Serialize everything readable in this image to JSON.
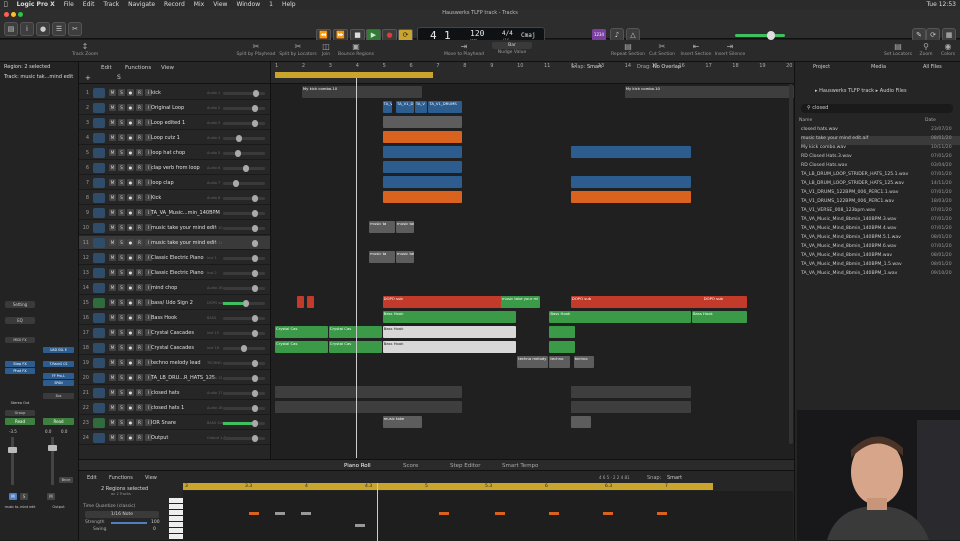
{
  "menubar": {
    "items": [
      "Logic Pro X",
      "File",
      "Edit",
      "Track",
      "Navigate",
      "Record",
      "Mix",
      "View",
      "Window",
      "1",
      "Help"
    ],
    "time": "Tue 12:53"
  },
  "window_title": "Hauswerks TLFP track - Tracks",
  "lcd": {
    "bar": "4",
    "beat": "1",
    "tempo": "120",
    "tempo_label": "KEEP",
    "timesig": "4/4",
    "timesig_bottom": "/16",
    "key": "Cmaj",
    "bar_label": "BAR",
    "beat_label": "BEAT",
    "tempo_sub": "TEMPO"
  },
  "cpu_label": "1234",
  "toolbar2": [
    {
      "label": "Track Zoom",
      "icon": "zoom-icon"
    },
    {
      "label": "Split by Playhead",
      "icon": "scissors-icon"
    },
    {
      "label": "Split by Locators",
      "icon": "split-icon"
    },
    {
      "label": "Join",
      "icon": "join-icon"
    },
    {
      "label": "Bounce Regions",
      "icon": "bounce-icon"
    },
    {
      "label": "Move to Playhead",
      "icon": "move-icon"
    },
    {
      "label": "Nudge Value",
      "icon": "nudge-icon"
    },
    {
      "label": "Repeat Section",
      "icon": "repeat-icon"
    },
    {
      "label": "Cut Section",
      "icon": "cut-icon"
    },
    {
      "label": "Insert Section",
      "icon": "insert-icon"
    },
    {
      "label": "Insert Silence",
      "icon": "silence-icon"
    },
    {
      "label": "Set Locators",
      "icon": "locators-icon"
    },
    {
      "label": "Zoom",
      "icon": "magnify-icon"
    },
    {
      "label": "Colors",
      "icon": "palette-icon"
    }
  ],
  "nudge_value": "Bar",
  "inspector": {
    "region": "Region: 2 selected",
    "track": "Track: music tak...mind edit",
    "setting": "Setting",
    "eq": "EQ",
    "midi_fx": "MIDI FX",
    "audio_fx": "Step FX",
    "audio_fx2": "Phat FX",
    "uad": "UAD SSL E",
    "track_cs": "T-RackS CS",
    "ff_pro": "FF Pro-L",
    "span": "SPAN",
    "send": "Bus",
    "output": "Stereo Out",
    "group": "Group",
    "read": "Read",
    "read2": "Read",
    "vol_left": "-3.5",
    "vol_right": "0.0",
    "vol_right2": "0.0",
    "mute": "M",
    "solo": "S",
    "bnce": "Bnce",
    "name_left": "music ta..mind edit",
    "name_right": "Output"
  },
  "tracks_header": {
    "edit": "Edit",
    "functions": "Functions",
    "view": "View",
    "snap_label": "Snap:",
    "snap_value": "Smart",
    "drag_label": "Drag:",
    "drag_value": "No Overlap"
  },
  "tracks": [
    {
      "num": "1",
      "name": "kick",
      "plug": "Audio 1",
      "fader": 0.82,
      "green": false,
      "selected": false
    },
    {
      "num": "2",
      "name": "Original Loop",
      "plug": "Audio 2",
      "fader": 0.8,
      "green": false,
      "selected": false
    },
    {
      "num": "3",
      "name": "Loop edited 1",
      "plug": "Audio 3",
      "fader": 0.8,
      "green": false,
      "selected": false
    },
    {
      "num": "4",
      "name": "Loop cutz 1",
      "plug": "Audio 4",
      "fader": 0.35,
      "green": false,
      "selected": false
    },
    {
      "num": "5",
      "name": "loop hat chop",
      "plug": "Audio 5",
      "fader": 0.32,
      "green": false,
      "selected": false
    },
    {
      "num": "6",
      "name": "clap verb from loop",
      "plug": "Audio 6",
      "fader": 0.55,
      "green": false,
      "selected": false
    },
    {
      "num": "7",
      "name": "loop clap",
      "plug": "Audio 7",
      "fader": 0.28,
      "green": false,
      "selected": false
    },
    {
      "num": "8",
      "name": "Kick",
      "plug": "Audio 8",
      "fader": 0.8,
      "green": false,
      "selected": false
    },
    {
      "num": "9",
      "name": "TA_VA_Music...min_140BPM",
      "plug": "Audio 9",
      "fader": 0.8,
      "green": false,
      "selected": false
    },
    {
      "num": "10",
      "name": "music take your mind edit",
      "plug": "Audio 10",
      "fader": 0.8,
      "green": false,
      "selected": false
    },
    {
      "num": "11",
      "name": "music take your mind edit",
      "plug": "Audio 11",
      "fader": 0.8,
      "green": false,
      "selected": true
    },
    {
      "num": "12",
      "name": "Classic Electric Piano",
      "plug": "Inst 1",
      "fader": 0.8,
      "green": false,
      "selected": false
    },
    {
      "num": "13",
      "name": "Classic Electric Piano",
      "plug": "Inst 2",
      "fader": 0.8,
      "green": false,
      "selected": false
    },
    {
      "num": "14",
      "name": "mind chop",
      "plug": "Audio 16",
      "fader": 0.8,
      "green": false,
      "selected": false
    },
    {
      "num": "15",
      "name": "bass/ Udo Sign 2",
      "plug": "DOPO sub",
      "fader": 0.55,
      "green": true,
      "selected": false
    },
    {
      "num": "16",
      "name": "Bass Hook",
      "plug": "BASS",
      "fader": 0.8,
      "green": false,
      "selected": false
    },
    {
      "num": "17",
      "name": "Crystal Cascades",
      "plug": "Inst 15",
      "fader": 0.8,
      "green": false,
      "selected": false
    },
    {
      "num": "18",
      "name": "Crystal Cascades",
      "plug": "Inst 16",
      "fader": 0.5,
      "green": false,
      "selected": false
    },
    {
      "num": "19",
      "name": "techno melody lead",
      "plug": "TECHNO",
      "fader": 0.8,
      "green": false,
      "selected": false
    },
    {
      "num": "20",
      "name": "TA_LB_DRU...R_HATS_125",
      "plug": "Audio 12",
      "fader": 0.8,
      "green": false,
      "selected": false
    },
    {
      "num": "21",
      "name": "closed hats",
      "plug": "Audio 17",
      "fader": 0.8,
      "green": false,
      "selected": false
    },
    {
      "num": "22",
      "name": "closed hats 1",
      "plug": "Audio 18",
      "fader": 0.8,
      "green": false,
      "selected": false
    },
    {
      "num": "23",
      "name": "IOR Snare",
      "plug": "BASS Snare",
      "fader": 0.8,
      "green": true,
      "selected": false
    },
    {
      "num": "24",
      "name": "Output",
      "plug": "Output 1-2",
      "fader": 0.8,
      "green": false,
      "selected": false
    }
  ],
  "ruler": [
    "1",
    "2",
    "3",
    "4",
    "5",
    "6",
    "7",
    "8",
    "9",
    "10",
    "11",
    "12",
    "13",
    "14",
    "15",
    "16",
    "17",
    "18",
    "19",
    "20"
  ],
  "regions": [
    {
      "row": 0,
      "start": 1,
      "end": 5.5,
      "color": "r-dark",
      "label": "My kick combo.10"
    },
    {
      "row": 0,
      "start": 13,
      "end": 20,
      "color": "r-dark",
      "label": "My kick combo.10"
    },
    {
      "row": 1,
      "start": 4,
      "end": 4.4,
      "color": "r-blue",
      "label": "TA_V"
    },
    {
      "row": 1,
      "start": 4.5,
      "end": 5.2,
      "color": "r-blue",
      "label": "TA_V1_D"
    },
    {
      "row": 1,
      "start": 5.2,
      "end": 5.7,
      "color": "r-blue",
      "label": "TA_V"
    },
    {
      "row": 1,
      "start": 5.7,
      "end": 7,
      "color": "r-blue",
      "label": "TA_V1_DRUMS"
    },
    {
      "row": 2,
      "start": 4,
      "end": 7,
      "color": "r-grey",
      "label": ""
    },
    {
      "row": 3,
      "start": 4,
      "end": 7,
      "color": "r-orange",
      "label": ""
    },
    {
      "row": 4,
      "start": 4,
      "end": 7,
      "color": "r-blue",
      "label": ""
    },
    {
      "row": 4,
      "start": 11,
      "end": 15.5,
      "color": "r-blue",
      "label": ""
    },
    {
      "row": 5,
      "start": 4,
      "end": 7,
      "color": "r-blue",
      "label": ""
    },
    {
      "row": 6,
      "start": 4,
      "end": 7,
      "color": "r-blue",
      "label": ""
    },
    {
      "row": 6,
      "start": 11,
      "end": 15.5,
      "color": "r-blue",
      "label": ""
    },
    {
      "row": 7,
      "start": 4,
      "end": 7,
      "color": "r-orange",
      "label": ""
    },
    {
      "row": 7,
      "start": 11,
      "end": 15.5,
      "color": "r-orange",
      "label": ""
    },
    {
      "row": 9,
      "start": 3.5,
      "end": 4.5,
      "color": "r-grey",
      "label": "music ta"
    },
    {
      "row": 9,
      "start": 4.5,
      "end": 5.2,
      "color": "r-grey",
      "label": "music take y"
    },
    {
      "row": 11,
      "start": 3.5,
      "end": 4.5,
      "color": "r-grey",
      "label": "music ta"
    },
    {
      "row": 11,
      "start": 4.5,
      "end": 5.2,
      "color": "r-grey",
      "label": "music take y"
    },
    {
      "row": 14,
      "start": 0.8,
      "end": 1.1,
      "color": "r-red",
      "label": ""
    },
    {
      "row": 14,
      "start": 1.2,
      "end": 1.5,
      "color": "r-red",
      "label": ""
    },
    {
      "row": 14,
      "start": 4,
      "end": 9,
      "color": "r-red",
      "label": "DOPO sub"
    },
    {
      "row": 14,
      "start": 8.4,
      "end": 9.9,
      "color": "r-green",
      "label": "music take your mi"
    },
    {
      "row": 14,
      "start": 11,
      "end": 16,
      "color": "r-red",
      "label": "DOPO sub"
    },
    {
      "row": 14,
      "start": 15.9,
      "end": 17.6,
      "color": "r-red",
      "label": "DOPO sub"
    },
    {
      "row": 15,
      "start": 4,
      "end": 9,
      "color": "r-green",
      "label": "Bass Hook"
    },
    {
      "row": 15,
      "start": 10.2,
      "end": 15.5,
      "color": "r-green",
      "label": "Bass Hook"
    },
    {
      "row": 15,
      "start": 15.5,
      "end": 17.6,
      "color": "r-green",
      "label": "Bass Hook"
    },
    {
      "row": 16,
      "start": 0,
      "end": 2,
      "color": "r-green",
      "label": "Crystal Cas"
    },
    {
      "row": 16,
      "start": 2,
      "end": 4,
      "color": "r-green",
      "label": "Crystal Cas"
    },
    {
      "row": 16,
      "start": 4,
      "end": 9,
      "color": "r-light",
      "label": "Bass Hook"
    },
    {
      "row": 16,
      "start": 10.2,
      "end": 11.2,
      "color": "r-green",
      "label": ""
    },
    {
      "row": 17,
      "start": 0,
      "end": 2,
      "color": "r-green",
      "label": "Crystal Cas"
    },
    {
      "row": 17,
      "start": 2,
      "end": 4,
      "color": "r-green",
      "label": "Crystal Cas"
    },
    {
      "row": 17,
      "start": 4,
      "end": 9,
      "color": "r-light",
      "label": "Bass Hook"
    },
    {
      "row": 17,
      "start": 10.2,
      "end": 11.2,
      "color": "r-green",
      "label": ""
    },
    {
      "row": 18,
      "start": 9,
      "end": 10.2,
      "color": "r-grey",
      "label": "techno melody lead"
    },
    {
      "row": 18,
      "start": 10.2,
      "end": 11,
      "color": "r-grey",
      "label": "techno"
    },
    {
      "row": 18,
      "start": 11.1,
      "end": 11.9,
      "color": "r-grey",
      "label": "techno"
    },
    {
      "row": 20,
      "start": 0,
      "end": 7,
      "color": "r-dark",
      "label": ""
    },
    {
      "row": 20,
      "start": 11,
      "end": 15.5,
      "color": "r-dark",
      "label": ""
    },
    {
      "row": 21,
      "start": 0,
      "end": 7,
      "color": "r-dark",
      "label": ""
    },
    {
      "row": 21,
      "start": 11,
      "end": 15.5,
      "color": "r-dark",
      "label": ""
    },
    {
      "row": 22,
      "start": 4,
      "end": 5.5,
      "color": "r-grey",
      "label": "music take"
    },
    {
      "row": 22,
      "start": 11,
      "end": 11.8,
      "color": "r-grey",
      "label": ""
    }
  ],
  "playhead_bar": 4,
  "browser": {
    "tab_project": "Project",
    "tab_media": "Media",
    "tab_all": "All Files",
    "path": "Hauswerks TLFP track",
    "path2": "Audio Files",
    "search": "closed",
    "col_name": "Name",
    "col_date": "Date",
    "files": [
      {
        "name": "closed hats.wav",
        "date": "23/07/20"
      },
      {
        "name": "music take your mind edit.aif",
        "date": "08/01/20"
      },
      {
        "name": "My kick combo.wav",
        "date": "10/11/20"
      },
      {
        "name": "RD Closed Hats.3.wav",
        "date": "07/01/20"
      },
      {
        "name": "RD Closed Hats.wav",
        "date": "03/04/20"
      },
      {
        "name": "TA_LB_DRUM_LOOP_STRIDER_HATS_125.1.wav",
        "date": "07/01/20"
      },
      {
        "name": "TA_LB_DRUM_LOOP_STRIDER_HATS_125.wav",
        "date": "14/11/20"
      },
      {
        "name": "TA_V1_DRUMS_122BPM_006_PERC1.1.wav",
        "date": "07/01/20"
      },
      {
        "name": "TA_V1_DRUMS_122BPM_006_PERC1.wav",
        "date": "18/03/20"
      },
      {
        "name": "TA_V1_VERSE_008_123bpm.wav",
        "date": "07/01/20"
      },
      {
        "name": "TA_VA_Music_Mind_8bmin_140BPM.3.wav",
        "date": "07/01/20"
      },
      {
        "name": "TA_VA_Music_Mind_8bmin_140BPM.4.wav",
        "date": "07/01/20"
      },
      {
        "name": "TA_VA_Music_Mind_8bmin_140BPM.5.1.wav",
        "date": "08/01/20"
      },
      {
        "name": "TA_VA_Music_Mind_8bmin_140BPM.6.wav",
        "date": "07/01/20"
      },
      {
        "name": "TA_VA_Music_Mind_8bmin_140BPM.wav",
        "date": "08/01/20"
      },
      {
        "name": "TA_VA_Music_Mind_8bmin_140BPM_1.5.wav",
        "date": "08/01/20"
      },
      {
        "name": "TA_VA_Music_Mind_8bmin_140BPM_1.wav",
        "date": "09/10/20"
      }
    ]
  },
  "editor": {
    "tabs": [
      "Piano Roll",
      "Score",
      "Step Editor",
      "Smart Tempo"
    ],
    "edit": "Edit",
    "functions": "Functions",
    "view": "View",
    "regions_selected": "2 Regions selected",
    "on_tracks": "on 2 Tracks",
    "time_quantize": "Time Quantize (classic)",
    "note_value": "1/16 Note",
    "strength_label": "Strength",
    "strength_value": "100",
    "swing_label": "Swing",
    "swing_value": "0",
    "position": "4 6 5 · 2 2 4 81",
    "snap_label": "Snap:",
    "snap_value": "Smart",
    "ruler": [
      "3",
      "3.3",
      "4",
      "4.3",
      "5",
      "5.3",
      "6",
      "6.3",
      "7"
    ]
  }
}
